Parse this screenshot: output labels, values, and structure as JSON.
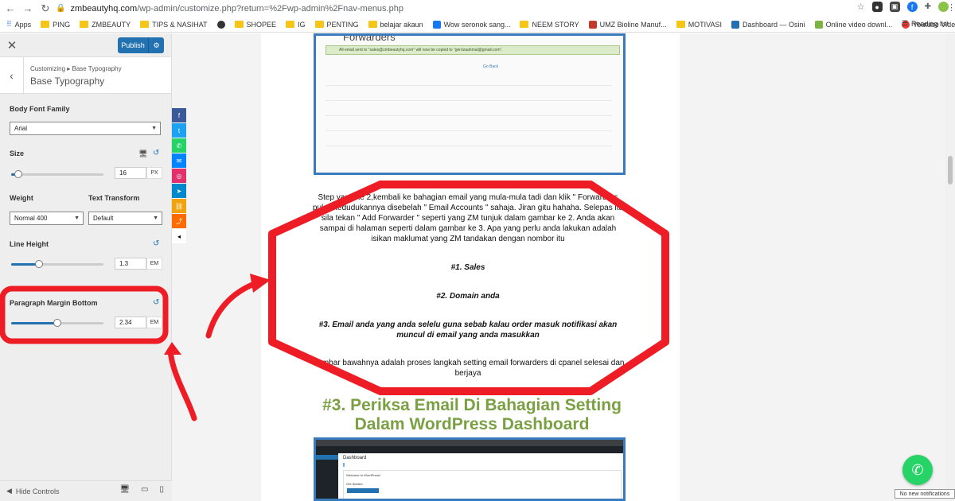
{
  "browser": {
    "url_host": "zmbeautyhq.com",
    "url_path": "/wp-admin/customize.php?return=%2Fwp-admin%2Fnav-menus.php",
    "bookmarks": [
      "Apps",
      "PING",
      "ZMBEAUTY",
      "TIPS & NASIHAT",
      "SHOPEE",
      "IG",
      "PENTING",
      "belajar akaun",
      "Wow seronok sang...",
      "NEEM STORY",
      "UMZ Bioline Manuf...",
      "MOTIVASI",
      "Dashboard — Osini",
      "Online video downl...",
      "Youtube Video Dow..."
    ],
    "reading_list": "Reading list"
  },
  "customizer": {
    "publish_label": "Publish",
    "breadcrumb": "Customizing ▸ Base Typography",
    "section_title": "Base Typography",
    "body_font_family_label": "Body Font Family",
    "body_font_family_value": "Arial",
    "size_label": "Size",
    "size_value": "16",
    "size_unit": "PX",
    "size_slider_fraction": 0.08,
    "weight_label": "Weight",
    "weight_value": "Normal 400",
    "text_transform_label": "Text Transform",
    "text_transform_value": "Default",
    "line_height_label": "Line Height",
    "line_height_value": "1.3",
    "line_height_unit": "EM",
    "line_height_slider_fraction": 0.3,
    "paragraph_margin_label": "Paragraph Margin Bottom",
    "paragraph_margin_value": "2.34",
    "paragraph_margin_unit": "EM",
    "paragraph_margin_slider_fraction": 0.5,
    "hide_controls_label": "Hide Controls"
  },
  "preview": {
    "shot1_title": "Forwarders",
    "shot1_bar_text": "All email sent to \"sales@zmbeautyhq.com\" will now be copied to \"gerrizaahmal@gmail.com\".",
    "shot1_link": "Go Back",
    "paragraph1": "Step yang ke 2,kembali ke bahagian email yang mula-mula tadi dan klik \" Forwarders pula. Kedudukannya disebelah \" Email Accounts \" sahaja. Jiran gitu hahaha. Selepas itu sila tekan \" Add Forwarder \" seperti yang ZM tunjuk dalam gambar ke 2. Anda akan sampai di halaman seperti dalam gambar ke 3. Apa yang perlu anda lakukan adalah isikan maklumat yang ZM tandakan dengan nombor itu",
    "item1": "#1. Sales",
    "item2": "#2. Domain anda",
    "item3": "#3. Email anda yang anda selelu guna sebab kalau order masuk notifikasi akan muncul di email yang anda masukkan",
    "paragraph2": "Gambar bawahnya adalah proses langkah setting email forwarders di cpanel selesai dan berjaya",
    "heading": "#3. Periksa Email Di Bahagian Setting Dalam WordPress Dashboard",
    "shot2_dashboard": "Dashboard",
    "shot2_welcome": "Welcome to WordPress!",
    "shot2_get_started": "Get Started"
  },
  "notification": "No new notifications",
  "colors": {
    "accent": "#2271b1",
    "heading_green": "#7aa043",
    "annotation_red": "#ee1c25",
    "frame_blue": "#3a7bbd"
  },
  "icons": {
    "share": [
      "facebook-icon",
      "twitter-icon",
      "whatsapp-icon",
      "messenger-icon",
      "instagram-icon",
      "telegram-icon",
      "link-icon",
      "share-icon"
    ]
  }
}
